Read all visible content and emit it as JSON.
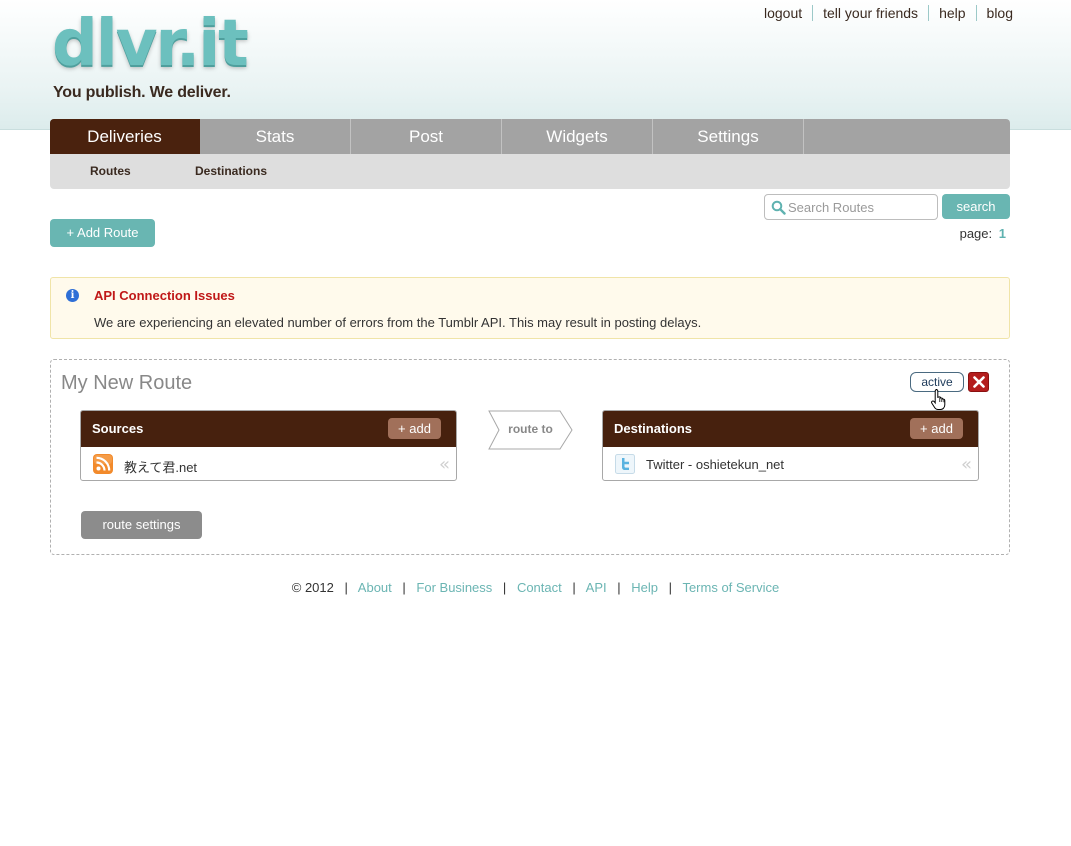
{
  "brand": {
    "logo_text": "dlvr.it",
    "tagline": "You publish. We deliver."
  },
  "toplinks": [
    "logout",
    "tell your friends",
    "help",
    "blog"
  ],
  "tabs": [
    "Deliveries",
    "Stats",
    "Post",
    "Widgets",
    "Settings"
  ],
  "active_tab": "Deliveries",
  "subtabs": [
    "Routes",
    "Destinations"
  ],
  "search": {
    "placeholder": "Search Routes",
    "button_label": "search"
  },
  "pager": {
    "label": "page:",
    "current": "1"
  },
  "add_route_label": "+ Add Route",
  "alert": {
    "title": "API Connection Issues",
    "message": "We are experiencing an elevated number of errors from the Tumblr API. This may result in posting delays."
  },
  "route": {
    "name": "My New Route",
    "status": "active",
    "sources": {
      "title": "Sources",
      "add_label": "+ add",
      "items": [
        {
          "icon": "rss-icon",
          "label": "教えて君.net"
        }
      ]
    },
    "route_to_label": "route to",
    "destinations": {
      "title": "Destinations",
      "add_label": "+ add",
      "items": [
        {
          "icon": "twitter-icon",
          "label": "Twitter - oshietekun_net"
        }
      ]
    },
    "settings_label": "route settings"
  },
  "footer": {
    "copyright": "© 2012",
    "links": [
      "About",
      "For Business",
      "Contact",
      "API",
      "Help",
      "Terms of Service"
    ]
  },
  "colors": {
    "brand_teal": "#6cc0be",
    "dark_brown": "#47210e",
    "alert_red": "#c01818",
    "link_teal": "#6bb5b3"
  }
}
